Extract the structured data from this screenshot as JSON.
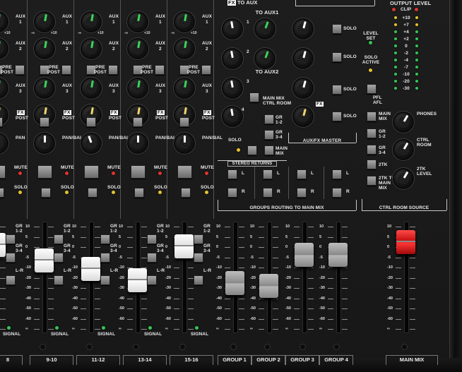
{
  "channel_strips": [
    {
      "id": "ch-8",
      "label": "8"
    },
    {
      "id": "ch-9-10",
      "label": "9-10"
    },
    {
      "id": "ch-11-12",
      "label": "11-12"
    },
    {
      "id": "ch-13-14",
      "label": "13-14"
    },
    {
      "id": "ch-15-16",
      "label": "15-16"
    }
  ],
  "group_strips": [
    {
      "id": "group-1",
      "label": "GROUP 1"
    },
    {
      "id": "group-2",
      "label": "GROUP 2"
    },
    {
      "id": "group-3",
      "label": "GROUP 3"
    },
    {
      "id": "group-4",
      "label": "GROUP 4"
    }
  ],
  "main_mix": {
    "label": "MAIN MIX"
  },
  "labels": {
    "aux": "AUX",
    "aux1": "1",
    "aux2": "2",
    "aux3": "3",
    "pre": "PRE",
    "post": "POST",
    "fx": "FX",
    "fxpost": "POST",
    "pan": "PAN",
    "panbal": "PAN/BAL",
    "mute": "MUTE",
    "solo": "SOLO",
    "signal": "SIGNAL",
    "gr12": "GR\n1-2",
    "gr34": "GR\n3-4",
    "lr": "L-R",
    "to_aux": "TO AUX",
    "to_aux1": "TO AUX1",
    "to_aux2": "TO AUX2",
    "main_mix_ctrl": "MAIN MIX\nCTRL ROOM",
    "level_set": "LEVEL\nSET",
    "solo_active": "SOLO\nACTIVE",
    "pfl": "PFL",
    "afl": "AFL",
    "aux_fx_master": "AUX/FX MASTER",
    "stereo_returns": "STEREO RETURNS",
    "groups_routing": "GROUPS ROUTING TO MAIN MIX",
    "ctrl_room_source": "CTRL ROOM SOURCE",
    "output_level": "OUTPUT LEVEL",
    "clip": "CLIP",
    "phones": "PHONES",
    "ctrl_room": "CTRL\nROOM",
    "track_level": "2TK\nLEVEL",
    "track": "2TK",
    "track_to_main": "2TK TO\nMAIN\nMIX",
    "main_mix_src": "MAIN\nMIX",
    "gr12_src": "GR\n1-2",
    "gr34_src": "GR\n3-4",
    "gr12_ret": "GR\n1-2",
    "gr34_ret": "GR\n3-4",
    "mainmix_ret": "MAIN\nMIX",
    "l": "L",
    "r": "R",
    "minus_inf": "-∞",
    "plus10": "+10"
  },
  "meter_scale": [
    "+10",
    "+7",
    "+4",
    "+2",
    "0",
    "-2",
    "-4",
    "-7",
    "-10",
    "-20",
    "-30"
  ],
  "fader_scale": [
    "10",
    "5",
    "0",
    "-5",
    "-10",
    "-20",
    "-30",
    "-40",
    "-50",
    "-60",
    "∞"
  ],
  "colors": {
    "knob_green": "#3bd45a",
    "knob_yellow": "#efd56d",
    "led_red": "#e0342a",
    "led_yellow": "#e6c22c",
    "led_green": "#34c654",
    "fader_white": "#f4f4f4",
    "fader_grey": "#9a9a9a",
    "fader_red": "#d6161b"
  },
  "indicators": {
    "mute_led": "red",
    "solo_led": "yellow",
    "signal_led": "green"
  }
}
